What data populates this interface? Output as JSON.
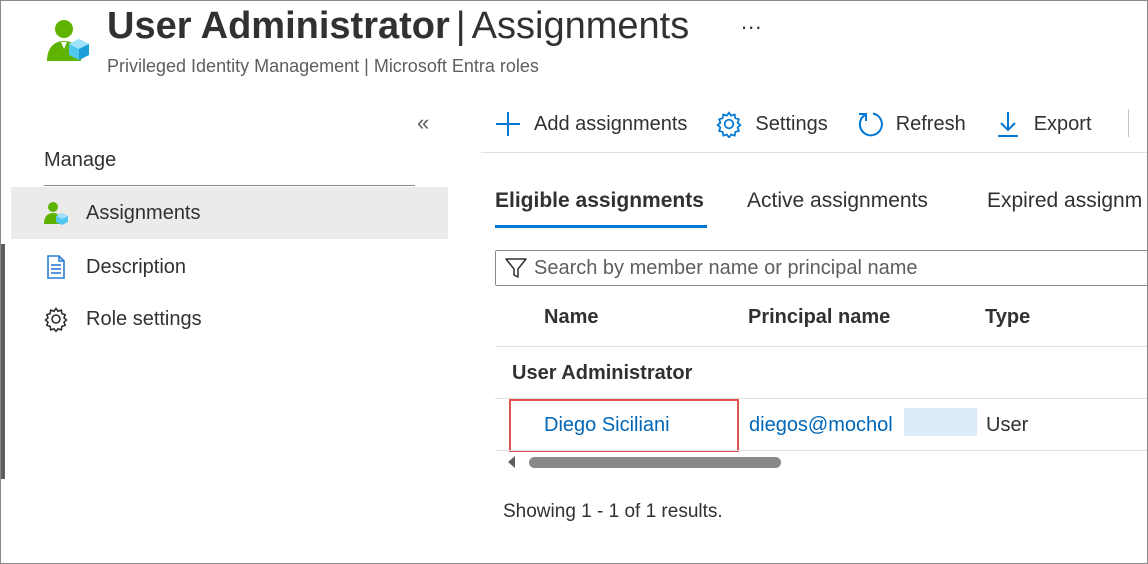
{
  "header": {
    "title_bold": "User Administrator",
    "title_separator": "|",
    "title_rest": "Assignments",
    "more": "...",
    "subtitle": "Privileged Identity Management | Microsoft Entra roles",
    "icon": "user-admin-role-icon"
  },
  "sidebar": {
    "collapse_glyph": "«",
    "section_title": "Manage",
    "items": [
      {
        "label": "Assignments",
        "icon": "user-assignment-icon",
        "active": true
      },
      {
        "label": "Description",
        "icon": "document-icon",
        "active": false
      },
      {
        "label": "Role settings",
        "icon": "gear-icon",
        "active": false
      }
    ]
  },
  "toolbar": {
    "items": [
      {
        "label": "Add assignments",
        "icon": "plus-icon"
      },
      {
        "label": "Settings",
        "icon": "gear-icon"
      },
      {
        "label": "Refresh",
        "icon": "refresh-icon"
      },
      {
        "label": "Export",
        "icon": "download-icon"
      }
    ]
  },
  "tabs": [
    {
      "label": "Eligible assignments",
      "active": true
    },
    {
      "label": "Active assignments",
      "active": false
    },
    {
      "label": "Expired assignm",
      "active": false
    }
  ],
  "search": {
    "placeholder": "Search by member name or principal name",
    "value": ""
  },
  "table": {
    "columns": [
      "Name",
      "Principal name",
      "Type"
    ],
    "group_label": "User Administrator",
    "rows": [
      {
        "name": "Diego Siciliani",
        "principal_name": "diegos@mochol",
        "type": "User"
      }
    ]
  },
  "results_text": "Showing 1 - 1 of 1 results.",
  "colors": {
    "accent": "#0078d4",
    "link": "#0067b8",
    "highlight_border": "#e05252",
    "active_nav_bg": "#edebe9"
  }
}
